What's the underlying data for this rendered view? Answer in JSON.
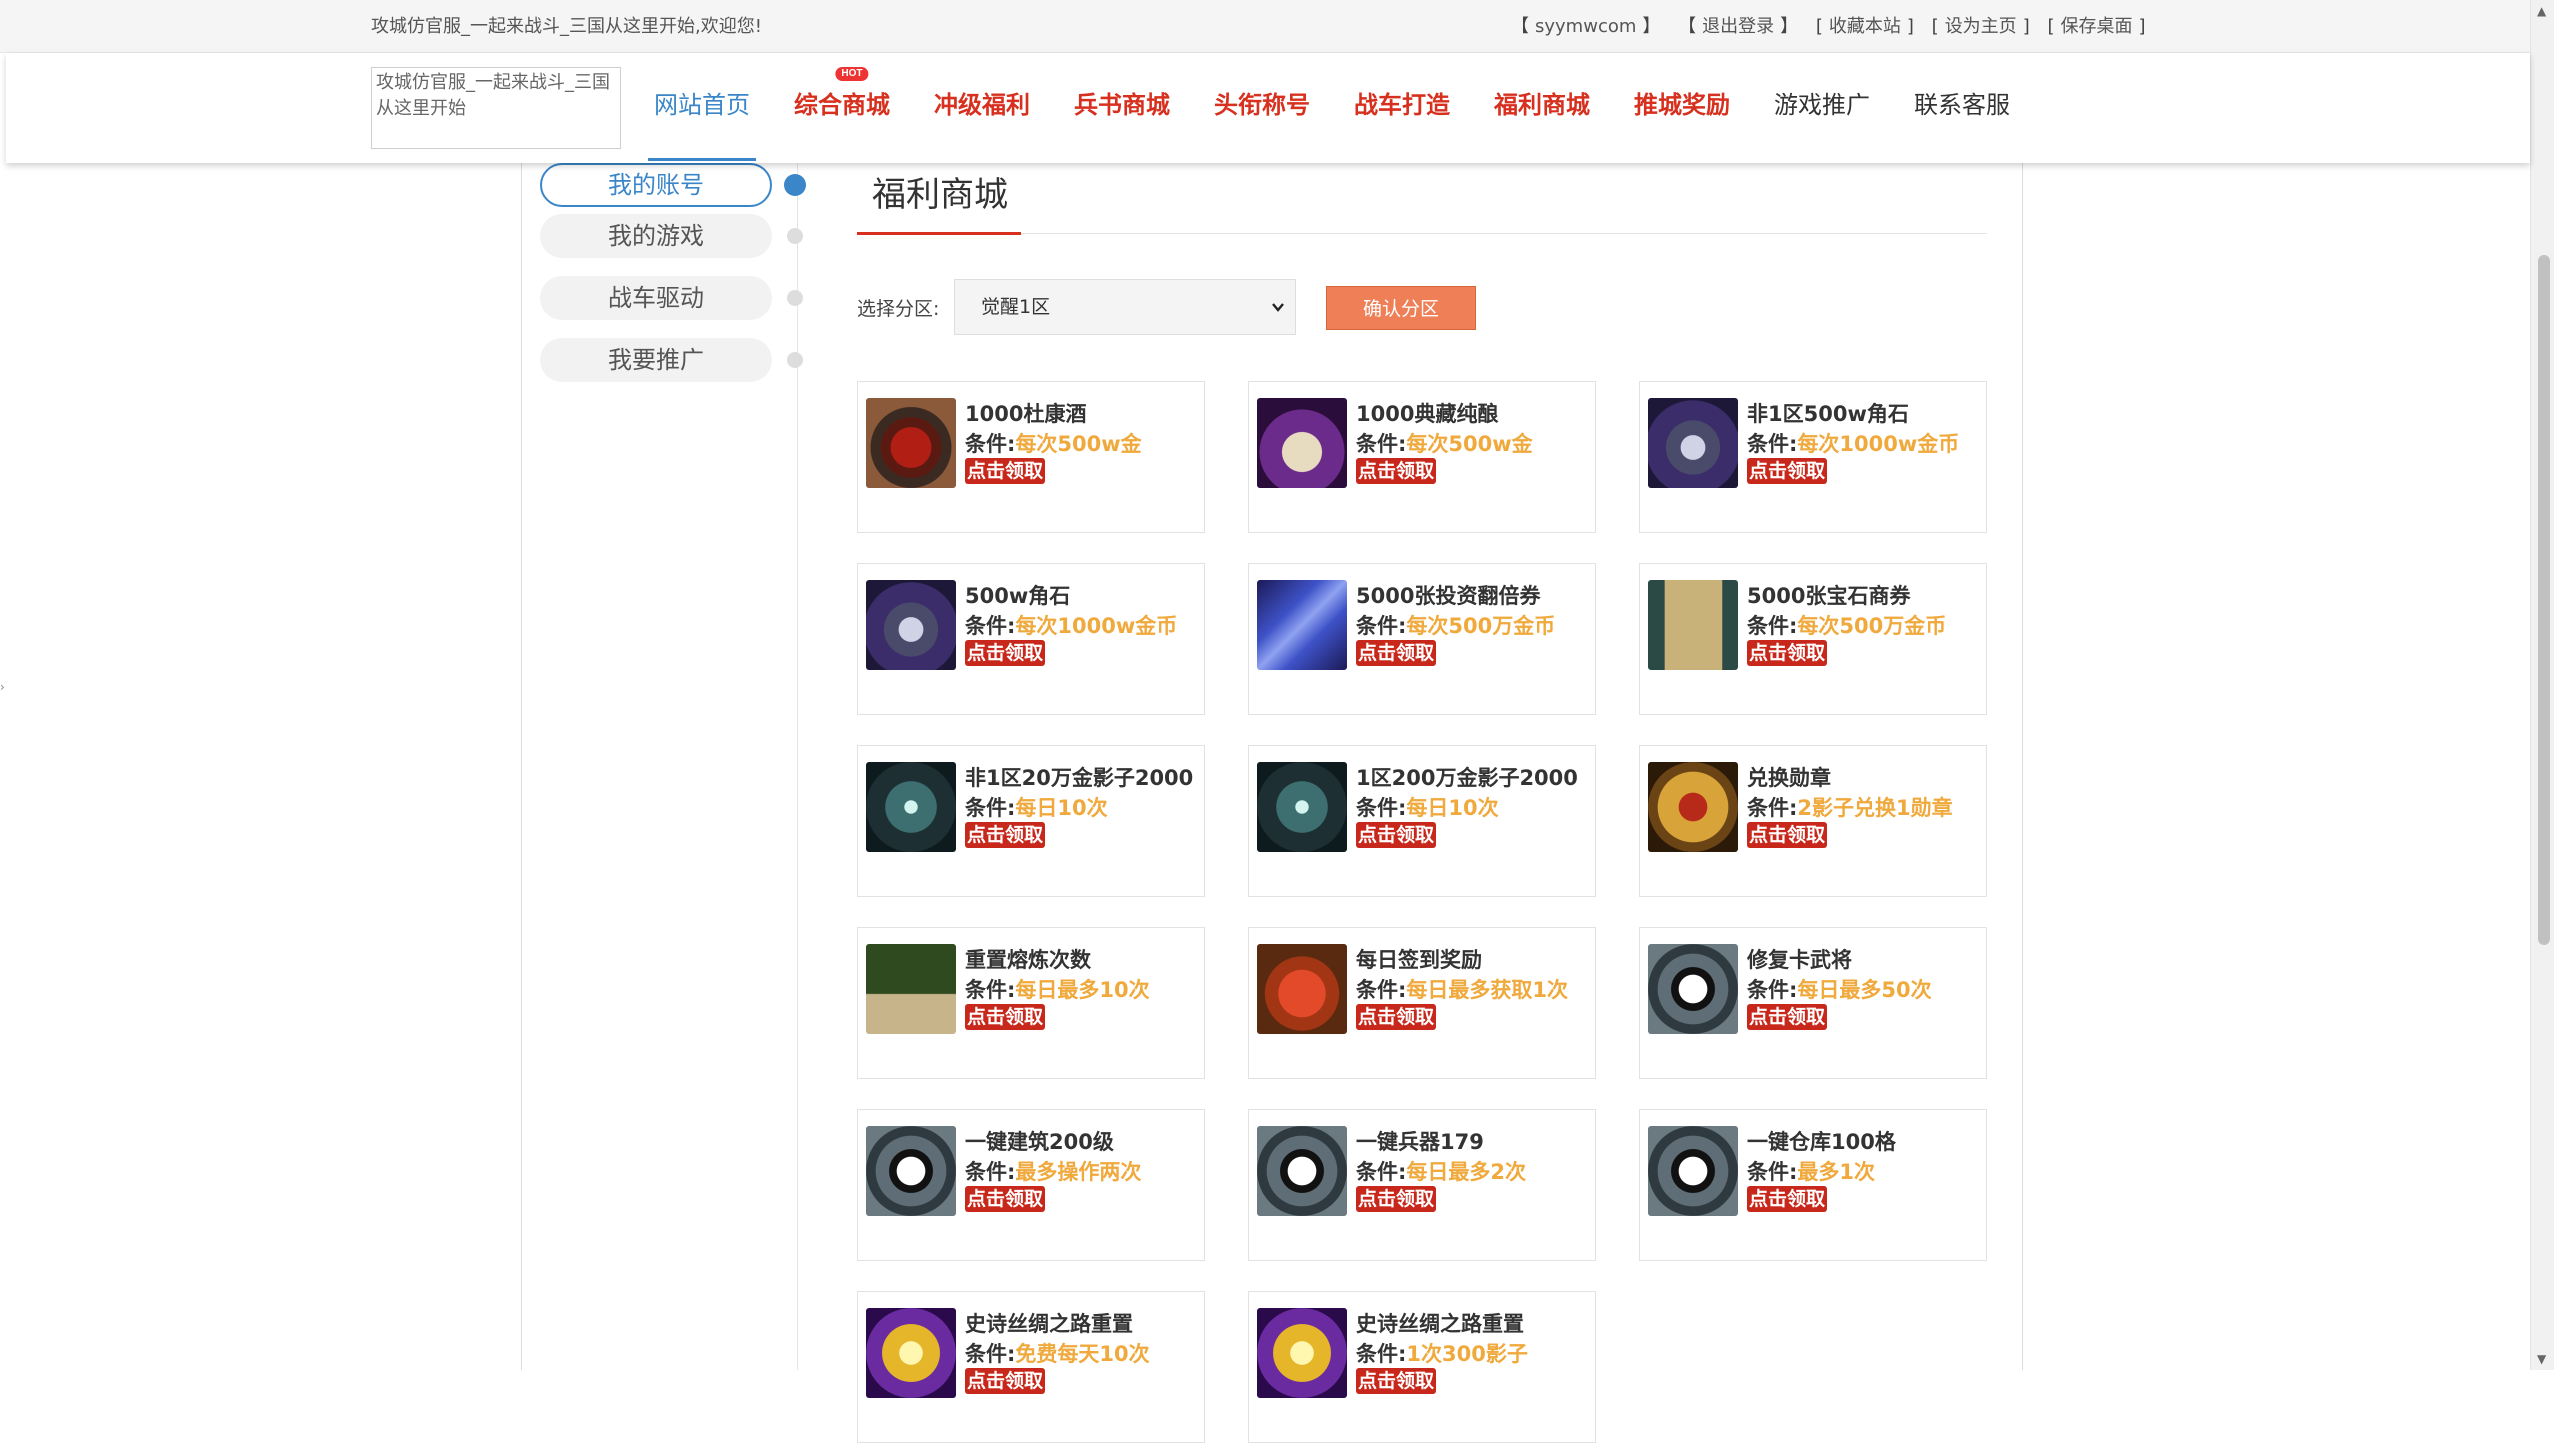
{
  "topbar": {
    "welcome": "攻城仿官服_一起来战斗_三国从这里开始,欢迎您!",
    "links": [
      "syymwcom",
      "退出登录",
      "收藏本站",
      "设为主页",
      "保存桌面"
    ]
  },
  "header": {
    "logo_alt": "攻城仿官服_一起来战斗_三国从这里开始",
    "nav": [
      {
        "label": "网站首页"
      },
      {
        "label": "综合商城",
        "badge": "HOT"
      },
      {
        "label": "冲级福利"
      },
      {
        "label": "兵书商城"
      },
      {
        "label": "头衔称号"
      },
      {
        "label": "战车打造"
      },
      {
        "label": "福利商城"
      },
      {
        "label": "推城奖励"
      },
      {
        "label": "游戏推广"
      },
      {
        "label": "联系客服"
      }
    ]
  },
  "sidebar": {
    "items": [
      {
        "label": "我的账号",
        "active": true
      },
      {
        "label": "我的游戏"
      },
      {
        "label": "战车驱动"
      },
      {
        "label": "我要推广"
      }
    ]
  },
  "main": {
    "title": "福利商城",
    "zone_label": "选择分区:",
    "zone_selected": "觉醒1区",
    "confirm_label": "确认分区",
    "cond_prefix": "条件:",
    "claim_label": "点击领取",
    "items": [
      {
        "name": "1000杜康酒",
        "cond": "每次500w金",
        "icon": "wine-jar-icon"
      },
      {
        "name": "1000典藏纯酿",
        "cond": "每次500w金",
        "icon": "teapot-icon"
      },
      {
        "name": "非1区500w角石",
        "cond": "每次1000w金币",
        "icon": "ore-stone-icon"
      },
      {
        "name": "500w角石",
        "cond": "每次1000w金币",
        "icon": "ore-stone-icon"
      },
      {
        "name": "5000张投资翻倍券",
        "cond": "每次500万金币",
        "icon": "coupon-icon"
      },
      {
        "name": "5000张宝石商券",
        "cond": "每次500万金币",
        "icon": "scroll-icon"
      },
      {
        "name": "非1区20万金影子2000",
        "cond": "每日10次",
        "icon": "blades-icon"
      },
      {
        "name": "1区200万金影子2000",
        "cond": "每日10次",
        "icon": "blades-icon"
      },
      {
        "name": "兑换勋章",
        "cond": "2影子兑换1勋章",
        "icon": "medal-icon"
      },
      {
        "name": "重置熔炼次数",
        "cond": "每日最多10次",
        "icon": "general-portrait-icon"
      },
      {
        "name": "每日签到奖励",
        "cond": "每日最多获取1次",
        "icon": "gift-box-icon"
      },
      {
        "name": "修复卡武将",
        "cond": "每日最多50次",
        "icon": "yin-yang-icon"
      },
      {
        "name": "一键建筑200级",
        "cond": "最多操作两次",
        "icon": "yin-yang-icon"
      },
      {
        "name": "一键兵器179",
        "cond": "每日最多2次",
        "icon": "yin-yang-icon"
      },
      {
        "name": "一键仓库100格",
        "cond": "最多1次",
        "icon": "yin-yang-icon"
      },
      {
        "name": "史诗丝绸之路重置",
        "cond": "免费每天10次",
        "icon": "golden-orb-icon"
      },
      {
        "name": "史诗丝绸之路重置",
        "cond": "1次300影子",
        "icon": "golden-orb-icon"
      }
    ]
  },
  "colors": {
    "accent_blue": "#3a86c8",
    "nav_red": "#d7301f",
    "condition_orange": "#f0a93c",
    "confirm_button": "#ee7f56",
    "claim_red": "#c8281b"
  }
}
